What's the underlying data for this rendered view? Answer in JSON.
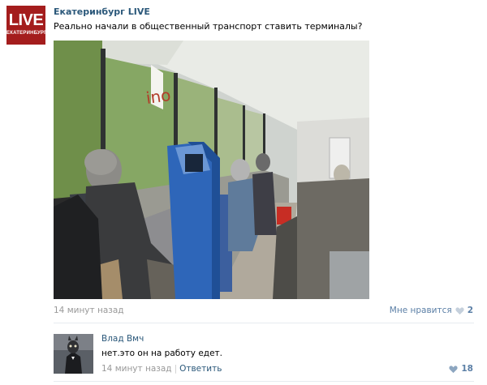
{
  "post": {
    "avatar_big": "LIVE",
    "avatar_small": "ЕКАТЕРИНБУРГ",
    "author": "Екатеринбург LIVE",
    "text": "Реально начали в общественный транспорт ставить терминалы?",
    "time": "14 минут назад",
    "like_label": "Мне нравится",
    "like_count": "2",
    "icons": {
      "like": "heart-icon"
    },
    "colors": {
      "link": "#2b587a",
      "avatar_bg": "#a41d1d",
      "meta": "#999999"
    }
  },
  "comment": {
    "author": "Влад Вмч",
    "text": "нет.это он на работу едет.",
    "time": "14 минут назад",
    "separator": "|",
    "reply_label": "Ответить",
    "like_count": "18"
  }
}
